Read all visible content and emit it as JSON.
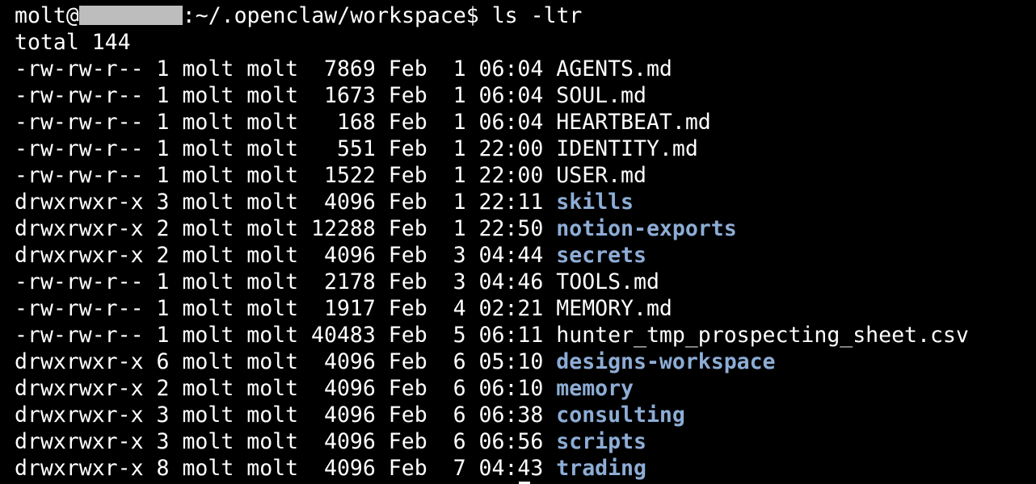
{
  "prompt": {
    "user": "molt@",
    "path": ":~/.openclaw/workspace$",
    "command": "ls -ltr"
  },
  "total": "total 144",
  "colors": {
    "background": "#000000",
    "text": "#ffffff",
    "directory": "#8dadd6",
    "redaction": "#bdbdbd"
  },
  "entries": [
    {
      "perms": "-rw-rw-r--",
      "links": "1",
      "owner": "molt",
      "group": "molt",
      "size": " 7869",
      "month": "Feb",
      "day": " 1",
      "time": "06:04",
      "name": "AGENTS.md",
      "is_dir": false
    },
    {
      "perms": "-rw-rw-r--",
      "links": "1",
      "owner": "molt",
      "group": "molt",
      "size": " 1673",
      "month": "Feb",
      "day": " 1",
      "time": "06:04",
      "name": "SOUL.md",
      "is_dir": false
    },
    {
      "perms": "-rw-rw-r--",
      "links": "1",
      "owner": "molt",
      "group": "molt",
      "size": "  168",
      "month": "Feb",
      "day": " 1",
      "time": "06:04",
      "name": "HEARTBEAT.md",
      "is_dir": false
    },
    {
      "perms": "-rw-rw-r--",
      "links": "1",
      "owner": "molt",
      "group": "molt",
      "size": "  551",
      "month": "Feb",
      "day": " 1",
      "time": "22:00",
      "name": "IDENTITY.md",
      "is_dir": false
    },
    {
      "perms": "-rw-rw-r--",
      "links": "1",
      "owner": "molt",
      "group": "molt",
      "size": " 1522",
      "month": "Feb",
      "day": " 1",
      "time": "22:00",
      "name": "USER.md",
      "is_dir": false
    },
    {
      "perms": "drwxrwxr-x",
      "links": "3",
      "owner": "molt",
      "group": "molt",
      "size": " 4096",
      "month": "Feb",
      "day": " 1",
      "time": "22:11",
      "name": "skills",
      "is_dir": true
    },
    {
      "perms": "drwxrwxr-x",
      "links": "2",
      "owner": "molt",
      "group": "molt",
      "size": "12288",
      "month": "Feb",
      "day": " 1",
      "time": "22:50",
      "name": "notion-exports",
      "is_dir": true
    },
    {
      "perms": "drwxrwxr-x",
      "links": "2",
      "owner": "molt",
      "group": "molt",
      "size": " 4096",
      "month": "Feb",
      "day": " 3",
      "time": "04:44",
      "name": "secrets",
      "is_dir": true
    },
    {
      "perms": "-rw-rw-r--",
      "links": "1",
      "owner": "molt",
      "group": "molt",
      "size": " 2178",
      "month": "Feb",
      "day": " 3",
      "time": "04:46",
      "name": "TOOLS.md",
      "is_dir": false
    },
    {
      "perms": "-rw-rw-r--",
      "links": "1",
      "owner": "molt",
      "group": "molt",
      "size": " 1917",
      "month": "Feb",
      "day": " 4",
      "time": "02:21",
      "name": "MEMORY.md",
      "is_dir": false
    },
    {
      "perms": "-rw-rw-r--",
      "links": "1",
      "owner": "molt",
      "group": "molt",
      "size": "40483",
      "month": "Feb",
      "day": " 5",
      "time": "06:11",
      "name": "hunter_tmp_prospecting_sheet.csv",
      "is_dir": false
    },
    {
      "perms": "drwxrwxr-x",
      "links": "6",
      "owner": "molt",
      "group": "molt",
      "size": " 4096",
      "month": "Feb",
      "day": " 6",
      "time": "05:10",
      "name": "designs-workspace",
      "is_dir": true
    },
    {
      "perms": "drwxrwxr-x",
      "links": "2",
      "owner": "molt",
      "group": "molt",
      "size": " 4096",
      "month": "Feb",
      "day": " 6",
      "time": "06:10",
      "name": "memory",
      "is_dir": true
    },
    {
      "perms": "drwxrwxr-x",
      "links": "3",
      "owner": "molt",
      "group": "molt",
      "size": " 4096",
      "month": "Feb",
      "day": " 6",
      "time": "06:38",
      "name": "consulting",
      "is_dir": true
    },
    {
      "perms": "drwxrwxr-x",
      "links": "3",
      "owner": "molt",
      "group": "molt",
      "size": " 4096",
      "month": "Feb",
      "day": " 6",
      "time": "06:56",
      "name": "scripts",
      "is_dir": true
    },
    {
      "perms": "drwxrwxr-x",
      "links": "8",
      "owner": "molt",
      "group": "molt",
      "size": " 4096",
      "month": "Feb",
      "day": " 7",
      "time": "04:43",
      "name": "trading",
      "is_dir": true
    }
  ]
}
